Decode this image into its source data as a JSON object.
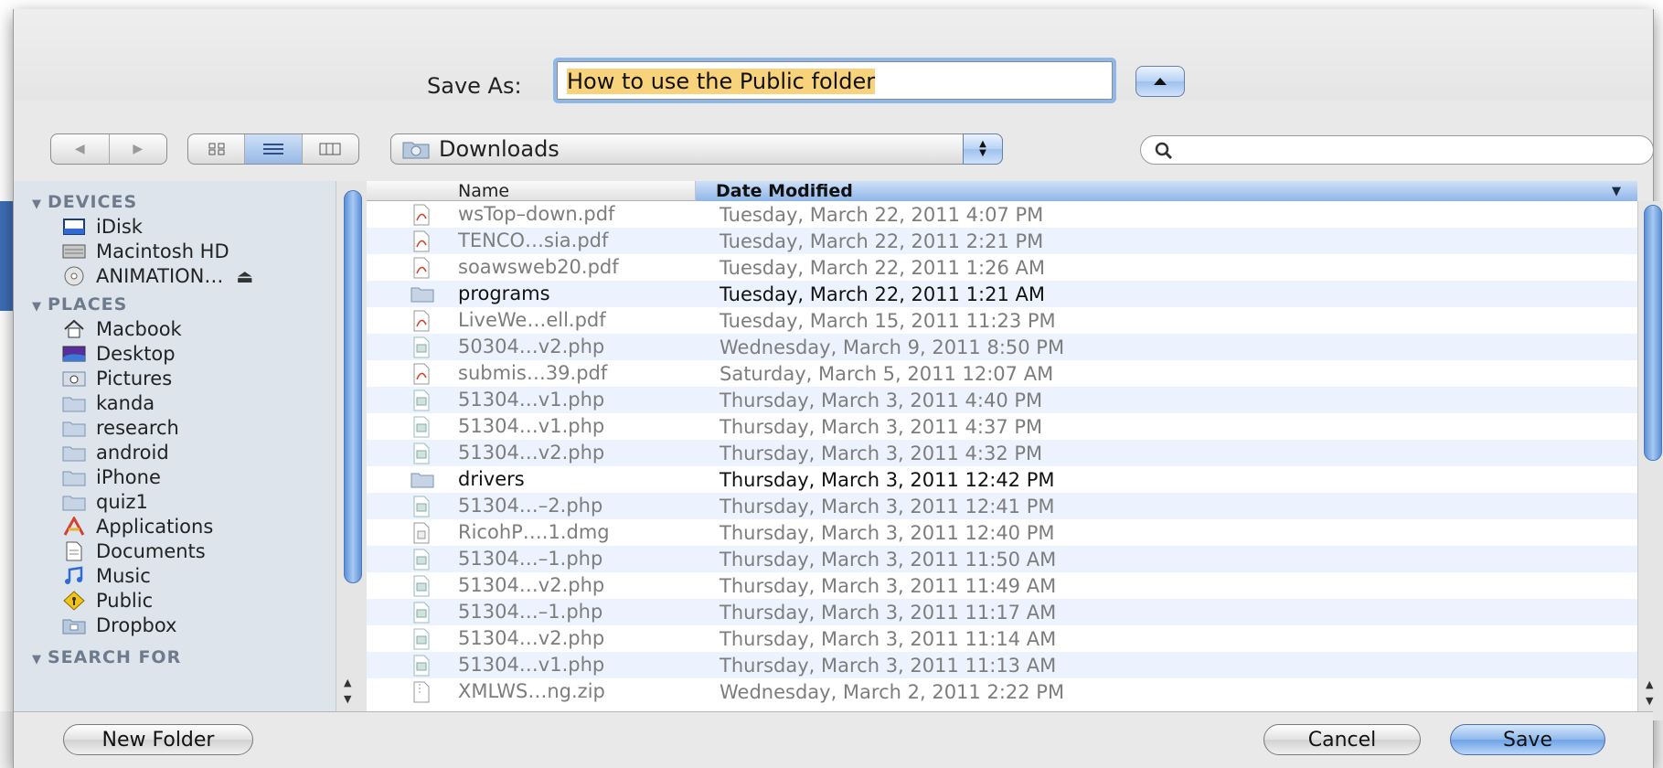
{
  "dialog": {
    "save_as_label": "Save As:",
    "save_as_value": "How to use the Public folder",
    "location": "Downloads",
    "search_placeholder": "",
    "buttons": {
      "new_folder": "New Folder",
      "cancel": "Cancel",
      "save": "Save"
    }
  },
  "sidebar": {
    "sections": {
      "devices": "DEVICES",
      "places": "PLACES",
      "search_for": "SEARCH FOR"
    },
    "devices": [
      {
        "label": "iDisk",
        "icon": "idisk-icon"
      },
      {
        "label": "Macintosh HD",
        "icon": "harddisk-icon"
      },
      {
        "label": "ANIMATION…",
        "icon": "cd-icon",
        "eject": "⏏"
      }
    ],
    "places": [
      {
        "label": "Macbook",
        "icon": "home-icon"
      },
      {
        "label": "Desktop",
        "icon": "desktop-icon"
      },
      {
        "label": "Pictures",
        "icon": "pictures-icon"
      },
      {
        "label": "kanda",
        "icon": "folder-icon"
      },
      {
        "label": "research",
        "icon": "folder-icon"
      },
      {
        "label": "android",
        "icon": "folder-icon"
      },
      {
        "label": "iPhone",
        "icon": "folder-icon"
      },
      {
        "label": "quiz1",
        "icon": "folder-icon"
      },
      {
        "label": "Applications",
        "icon": "applications-icon"
      },
      {
        "label": "Documents",
        "icon": "documents-icon"
      },
      {
        "label": "Music",
        "icon": "music-icon"
      },
      {
        "label": "Public",
        "icon": "public-icon"
      },
      {
        "label": "Dropbox",
        "icon": "dropbox-icon"
      }
    ]
  },
  "file_list": {
    "columns": {
      "name": "Name",
      "date": "Date Modified"
    },
    "rows": [
      {
        "name": "wsTop–down.pdf",
        "date": "Tuesday, March 22, 2011 4:07 PM",
        "kind": "pdf"
      },
      {
        "name": "TENCO…sia.pdf",
        "date": "Tuesday, March 22, 2011 2:21 PM",
        "kind": "pdf"
      },
      {
        "name": "soawsweb20.pdf",
        "date": "Tuesday, March 22, 2011 1:26 AM",
        "kind": "pdf"
      },
      {
        "name": "programs",
        "date": "Tuesday, March 22, 2011 1:21 AM",
        "kind": "folder"
      },
      {
        "name": "LiveWe…ell.pdf",
        "date": "Tuesday, March 15, 2011 11:23 PM",
        "kind": "pdf"
      },
      {
        "name": "50304…v2.php",
        "date": "Wednesday, March 9, 2011 8:50 PM",
        "kind": "php"
      },
      {
        "name": "submis…39.pdf",
        "date": "Saturday, March 5, 2011 12:07 AM",
        "kind": "pdf"
      },
      {
        "name": "51304…v1.php",
        "date": "Thursday, March 3, 2011 4:40 PM",
        "kind": "php"
      },
      {
        "name": "51304…v1.php",
        "date": "Thursday, March 3, 2011 4:37 PM",
        "kind": "php"
      },
      {
        "name": "51304…v2.php",
        "date": "Thursday, March 3, 2011 4:32 PM",
        "kind": "php"
      },
      {
        "name": "drivers",
        "date": "Thursday, March 3, 2011 12:42 PM",
        "kind": "folder"
      },
      {
        "name": "51304…–2.php",
        "date": "Thursday, March 3, 2011 12:41 PM",
        "kind": "php"
      },
      {
        "name": "RicohP….1.dmg",
        "date": "Thursday, March 3, 2011 12:40 PM",
        "kind": "dmg"
      },
      {
        "name": "51304…–1.php",
        "date": "Thursday, March 3, 2011 11:50 AM",
        "kind": "php"
      },
      {
        "name": "51304…v2.php",
        "date": "Thursday, March 3, 2011 11:49 AM",
        "kind": "php"
      },
      {
        "name": "51304…–1.php",
        "date": "Thursday, March 3, 2011 11:17 AM",
        "kind": "php"
      },
      {
        "name": "51304…v2.php",
        "date": "Thursday, March 3, 2011 11:14 AM",
        "kind": "php"
      },
      {
        "name": "51304…v1.php",
        "date": "Thursday, March 3, 2011 11:13 AM",
        "kind": "php"
      },
      {
        "name": "XMLWS…ng.zip",
        "date": "Wednesday, March 2, 2011 2:22 PM",
        "kind": "zip"
      }
    ]
  },
  "colors": {
    "selection_highlight": "#f9d27c",
    "focus_ring": "#8fb7e8",
    "sidebar_bg": "#dde4ec",
    "alt_row": "#edf3fe",
    "accent_button": "#6ea2e6"
  }
}
